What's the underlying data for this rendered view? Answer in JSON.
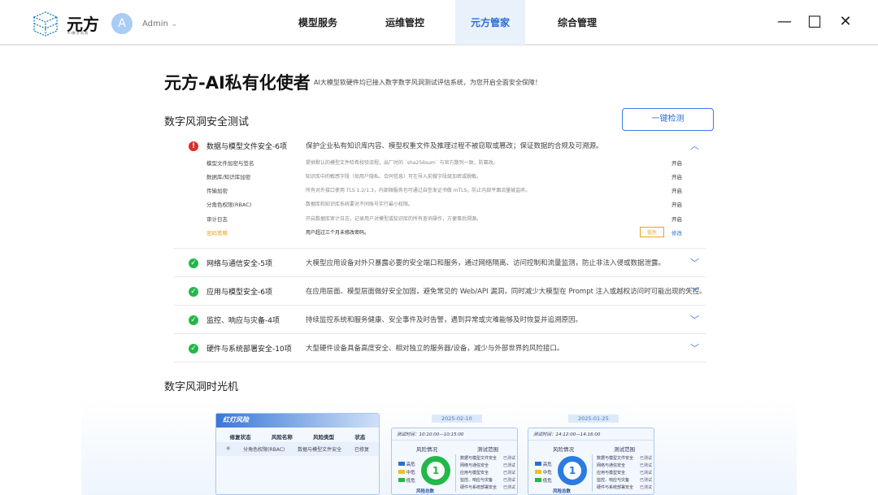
{
  "header": {
    "brand": "元方",
    "brand_sub": "AI数字风洞",
    "user": "Admin",
    "avatar": "A",
    "tabs": [
      {
        "label": "模型服务"
      },
      {
        "label": "运维管控"
      },
      {
        "label": "元方管家"
      },
      {
        "label": "综合管理"
      }
    ],
    "window": {
      "minimize": "—",
      "maximize": "☐",
      "close": "✕"
    }
  },
  "page": {
    "title": "元方-AI私有化使者",
    "subtitle": "AI大模型软硬件均已接入数字数字风洞测试评估系统，为您开启全面安全保障！"
  },
  "test": {
    "title": "数字风洞安全测试",
    "button": "一键检测",
    "categories": [
      {
        "name": "数据与模型文件安全-6项",
        "desc": "保护企业私有知识库内容、模型权重文件及推理过程不被窃取或篡改；保证数据的合规及可溯源。",
        "status": "warning",
        "items": [
          {
            "name": "模型文件加密与签名",
            "desc": "提供默认的模型文件哈希校验流程，出厂时的 `sha256sum` 与官方散列一致，防篡改。",
            "state": "开启"
          },
          {
            "name": "数据库/知识库加密",
            "desc": "知识库中的敏感字段（如用户隐私、合同信息）可在导入前做字段级加密或脱敏。",
            "state": "开启"
          },
          {
            "name": "传输加密",
            "desc": "所有对外接口使用 TLS 1.2/1.3，内部微服务也可通过自签发证书做 mTLS，防止内部平面流量被监听。",
            "state": "开启"
          },
          {
            "name": "分角色权限(RBAC)",
            "desc": "数据库和知识库系统要对不同账号实行最小权限。",
            "state": "开启"
          },
          {
            "name": "审计日志",
            "desc": "开启数据库审计日志，记录用户对模型或知识库的所有查询操作，方便事后溯源。",
            "state": "开启"
          },
          {
            "name": "密码策略",
            "desc": "用户超过三个月未修改密码。",
            "badge": "低危",
            "state": "修改"
          }
        ]
      },
      {
        "name": "网络与通信安全-5项",
        "desc": "大模型应用设备对外只暴露必要的安全端口和服务，通过网络隔离、访问控制和流量监测，防止非法入侵或数据泄露。",
        "status": "ok"
      },
      {
        "name": "应用与模型安全-6项",
        "desc": "在应用层面、模型层面做好安全加固，避免常见的 Web/API 漏洞，同时减少大模型在 Prompt 注入或越权访问时可能出现的失控。",
        "status": "ok"
      },
      {
        "name": "监控、响应与灾备-4项",
        "desc": "持续监控系统和服务健康、安全事件及时告警，遇到异常或灾难能够及时恢复并追溯原因。",
        "status": "ok"
      },
      {
        "name": "硬件与系统部署安全-10项",
        "desc": "大型硬件设备具备高度安全、相对独立的服务器/设备，减少与外部世界的风险接口。",
        "status": "ok"
      }
    ]
  },
  "timemachine": {
    "title": "数字风洞时光机",
    "risk_panel": {
      "title": "红灯风险",
      "headers": [
        "修复状态",
        "风险名称",
        "风险类型",
        "状态"
      ],
      "row": [
        "分角色权限(RBAC)",
        "数据与模型文件安全",
        "已修复"
      ]
    },
    "records": [
      {
        "date": "2025-02-10",
        "time": "测试时间：10:10:00—10:15:00",
        "color": "#22b84a"
      },
      {
        "date": "2025-01-25",
        "time": "测试时间：14:12:00—14:16:00",
        "color": "#2b7be0"
      }
    ],
    "risk_title": "风险情况",
    "scope_title": "测试范围",
    "levels": [
      "高危",
      "中危",
      "低危"
    ],
    "total": "1",
    "total_label": "风险总数",
    "scope": [
      "数据与模型文件安全",
      "网络与通信安全",
      "应用与模型安全",
      "监控、响应与灾备",
      "硬件与系统部署安全"
    ],
    "tested": "已测试"
  },
  "colors": {
    "accent": "#2b6fd6",
    "ok": "#22b84a",
    "warn": "#e02b2b",
    "badge": "#f0a020"
  }
}
